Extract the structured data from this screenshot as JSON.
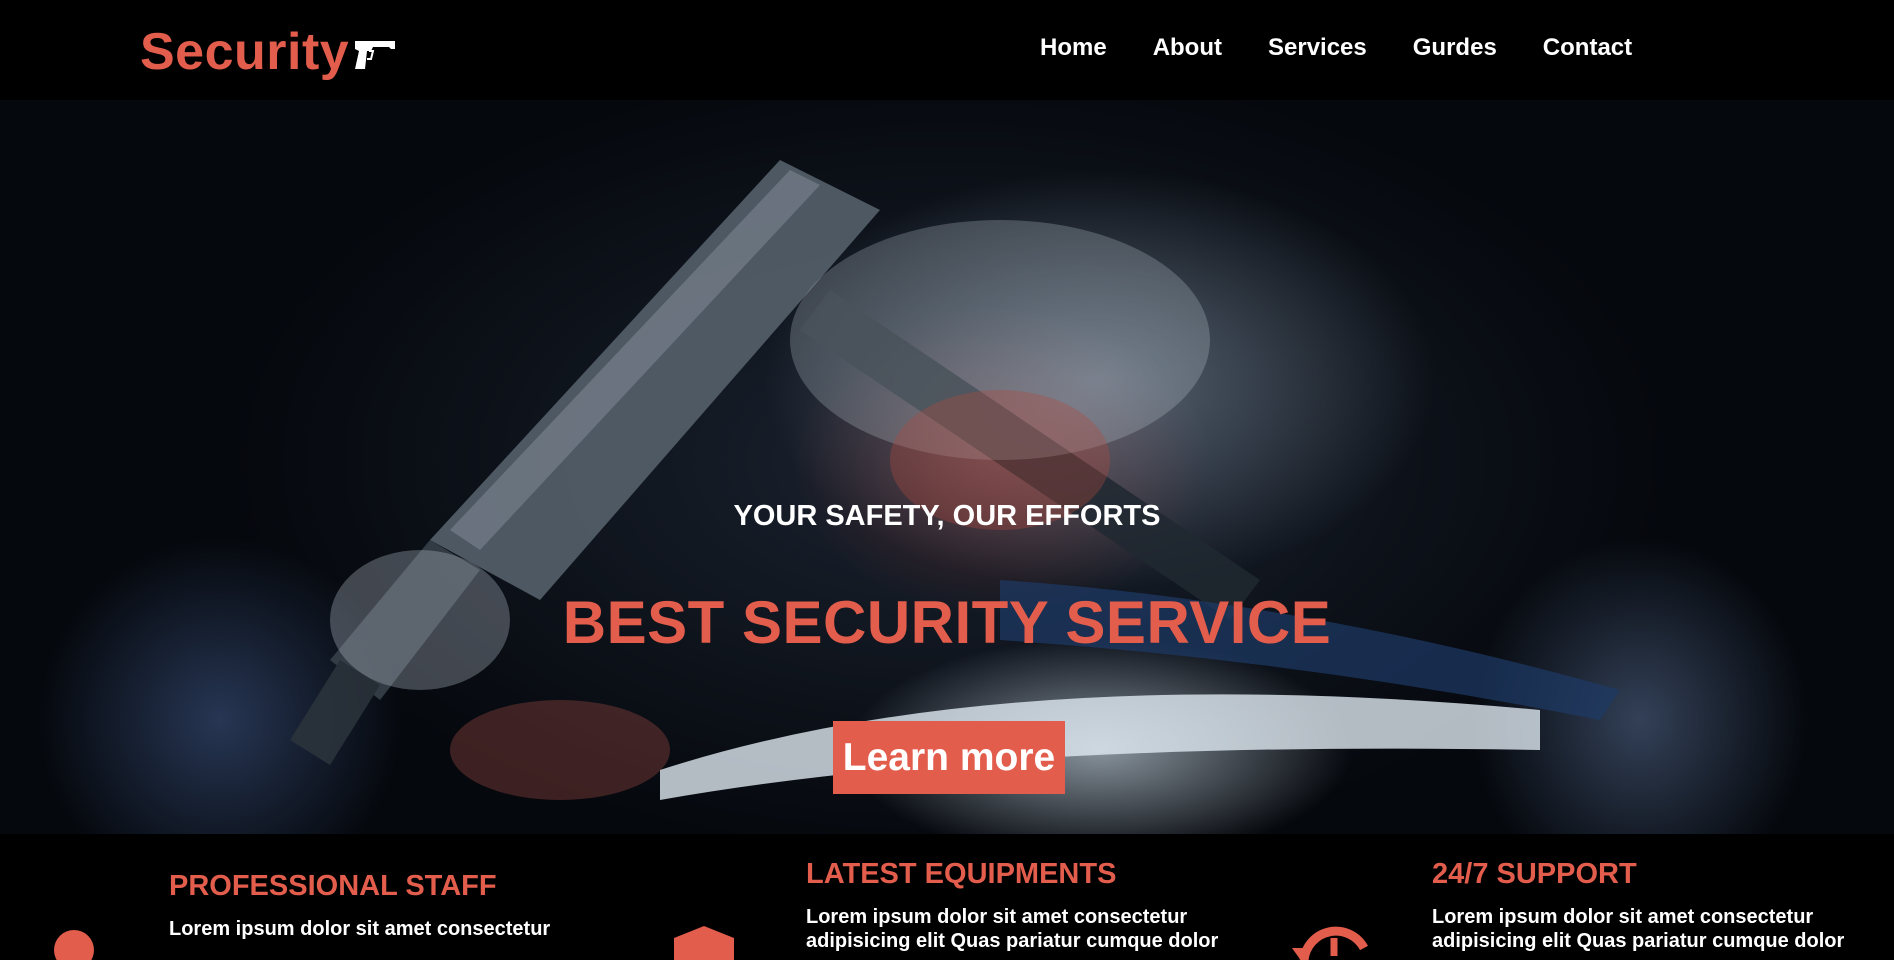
{
  "brand": {
    "name": "Security",
    "icon": "pistol-icon"
  },
  "nav": {
    "items": [
      "Home",
      "About",
      "Services",
      "Gurdes",
      "Contact"
    ]
  },
  "hero": {
    "tagline": "YOUR SAFETY, OUR EFFORTS",
    "title": "BEST SECURITY SERVICE",
    "cta_label": "Learn more"
  },
  "features": [
    {
      "title": "PROFESSIONAL STAFF",
      "text": "Lorem ipsum dolor sit amet consectetur",
      "icon": "user-icon"
    },
    {
      "title": "LATEST EQUIPMENTS",
      "text": "Lorem ipsum dolor sit amet consectetur adipisicing elit Quas pariatur cumque dolor",
      "icon": "shield-icon"
    },
    {
      "title": "24/7 SUPPORT",
      "text": "Lorem ipsum dolor sit amet consectetur adipisicing elit Quas pariatur cumque dolor",
      "icon": "history-icon"
    }
  ],
  "colors": {
    "accent": "#e35d4c",
    "background": "#000000",
    "text": "#ffffff"
  }
}
